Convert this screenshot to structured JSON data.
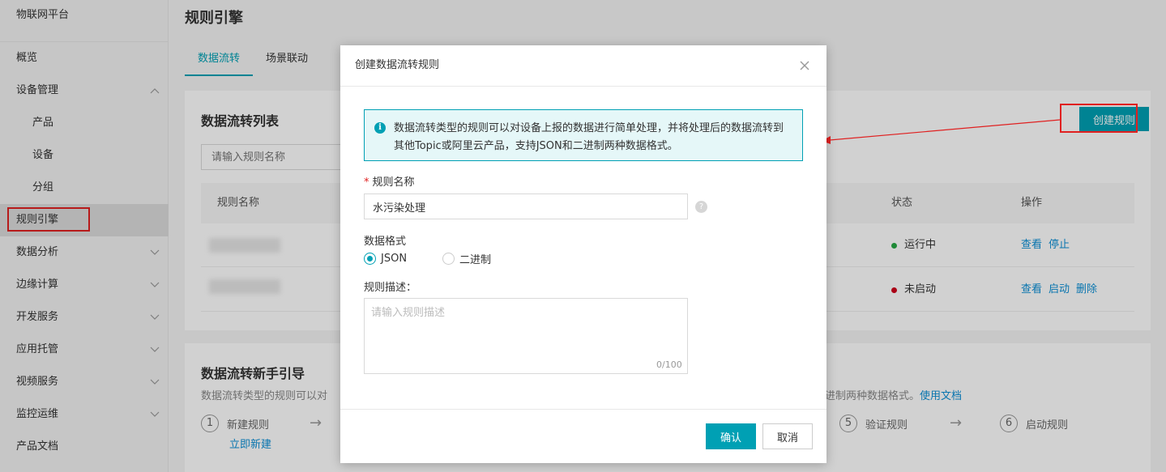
{
  "sidebar": {
    "brand": "物联网平台",
    "items": [
      {
        "label": "概览",
        "chevron": ""
      },
      {
        "label": "设备管理",
        "chevron": "up"
      },
      {
        "label": "产品",
        "chevron": ""
      },
      {
        "label": "设备",
        "chevron": ""
      },
      {
        "label": "分组",
        "chevron": ""
      },
      {
        "label": "规则引擎",
        "chevron": "",
        "active": true
      },
      {
        "label": "数据分析",
        "chevron": "down"
      },
      {
        "label": "边缘计算",
        "chevron": "down"
      },
      {
        "label": "开发服务",
        "chevron": "down"
      },
      {
        "label": "应用托管",
        "chevron": "down"
      },
      {
        "label": "视频服务",
        "chevron": "down"
      },
      {
        "label": "监控运维",
        "chevron": "down"
      },
      {
        "label": "产品文档",
        "chevron": ""
      }
    ]
  },
  "main": {
    "title": "规则引擎",
    "tabs": [
      "数据流转",
      "场景联动"
    ],
    "list": {
      "title": "数据流转列表",
      "search_placeholder": "请输入规则名称",
      "create_button": "创建规则",
      "columns": {
        "name": "规则名称",
        "status": "状态",
        "ops": "操作"
      },
      "rows": [
        {
          "status": "运行中",
          "status_color": "#27a844",
          "ops": [
            "查看",
            "停止"
          ]
        },
        {
          "status": "未启动",
          "status_color": "#d0021b",
          "ops": [
            "查看",
            "启动",
            "删除"
          ]
        }
      ]
    },
    "guide": {
      "title": "数据流转新手引导",
      "desc_left": "数据流转类型的规则可以对",
      "desc_right": "进制两种数据格式。",
      "doc_link": "使用文档",
      "steps": [
        {
          "num": "1",
          "label": "新建规则",
          "link": "立即新建"
        },
        {
          "num": "5",
          "label": "验证规则"
        },
        {
          "num": "6",
          "label": "启动规则"
        }
      ]
    }
  },
  "modal": {
    "title": "创建数据流转规则",
    "alert": "数据流转类型的规则可以对设备上报的数据进行简单处理，并将处理后的数据流转到其他Topic或阿里云产品，支持JSON和二进制两种数据格式。",
    "name_label": "规则名称",
    "name_value": "水污染处理",
    "format_label": "数据格式",
    "format_options": [
      "JSON",
      "二进制"
    ],
    "format_selected": "JSON",
    "desc_label": "规则描述：",
    "desc_placeholder": "请输入规则描述",
    "counter": "0/100",
    "ok": "确认",
    "cancel": "取消"
  },
  "icons": {
    "close": "close-icon",
    "info": "info-icon",
    "help": "help-icon",
    "chevron": "chevron-icon"
  },
  "colors": {
    "accent": "#00a0b4",
    "annotation": "#e02020",
    "link": "#0b8fd6"
  }
}
